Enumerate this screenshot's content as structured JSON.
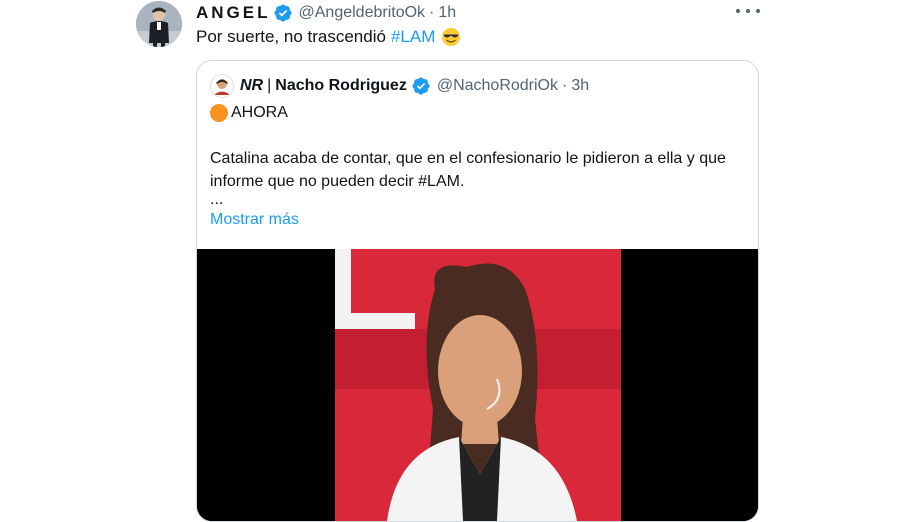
{
  "tweet": {
    "author_name": "ANGEL",
    "handle": "@AngeldebritoOk",
    "separator": "·",
    "time": "1h",
    "text": "Por suerte, no trascendió",
    "hashtag": "#LAM",
    "emoji_icon": "smiling-face-with-sunglasses-icon"
  },
  "quoted": {
    "brand": "NR",
    "separator_bar": "|",
    "author_name": "Nacho Rodriguez",
    "handle": "@NachoRodriOk",
    "separator": "·",
    "time": "3h",
    "status": "AHORA",
    "body": "Catalina acaba de contar, que en el confesionario le pidieron a ella y que informe que no pueden decir #LAM.",
    "ellipsis": "...",
    "show_more": "Mostrar más"
  },
  "colors": {
    "link": "#1d9bf0",
    "verified": "#1d9bf0",
    "secondary_text": "#536471",
    "status_dot": "#f7931e",
    "border": "#cfd9de"
  }
}
